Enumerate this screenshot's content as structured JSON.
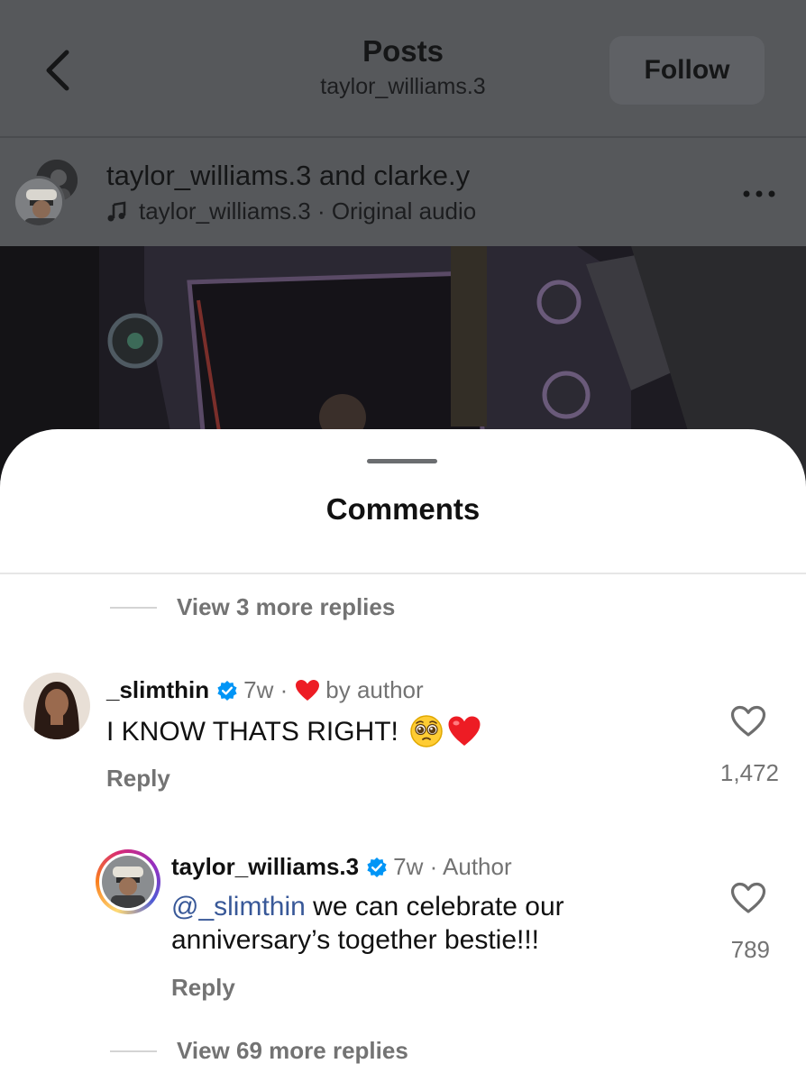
{
  "header": {
    "title": "Posts",
    "subtitle": "taylor_williams.3",
    "follow_label": "Follow"
  },
  "post": {
    "users": "taylor_williams.3 and clarke.y",
    "audio": "taylor_williams.3 · Original audio"
  },
  "comments_sheet": {
    "title": "Comments",
    "view_more_top": "View 3 more replies",
    "comment": {
      "username": "_slimthin",
      "time": "7w ·",
      "liked_by": "by author",
      "text": "I KNOW THATS RIGHT!",
      "reply_label": "Reply",
      "like_count": "1,472"
    },
    "reply": {
      "username": "taylor_williams.3",
      "time": "7w · Author",
      "mention": "@_slimthin",
      "text_line1": " we can celebrate our",
      "text_line2": "anniversary’s together bestie!!!",
      "reply_label": "Reply",
      "like_count": "789"
    },
    "view_more_bottom": "View 69 more replies"
  },
  "colors": {
    "mention": "#385898",
    "verified": "#0095f6",
    "heart": "#ed1c24",
    "muted_text": "#737373"
  },
  "icons": [
    "chevron-left-icon",
    "music-note-icon",
    "more-horizontal-icon",
    "verified-badge-icon",
    "heart-filled-icon",
    "pleading-face-emoji",
    "red-heart-emoji",
    "heart-outline-icon"
  ]
}
